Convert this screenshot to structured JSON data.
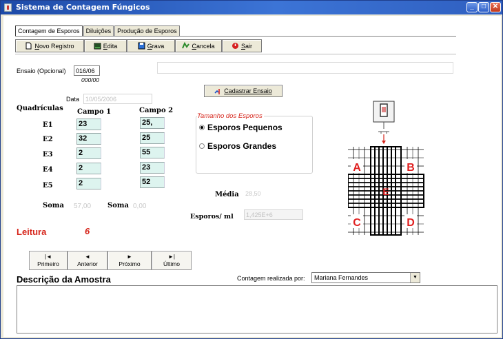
{
  "window": {
    "title": "Sistema de Contagem Fúngicos"
  },
  "tabs": [
    "Contagem de Esporos",
    "Diluições",
    "Produção de Esporos"
  ],
  "toolbar": {
    "novo": {
      "prefix": "",
      "key": "N",
      "rest": "ovo Registro"
    },
    "edita": {
      "key": "E",
      "rest": "dita"
    },
    "grava": {
      "key": "G",
      "rest": "rava"
    },
    "cancela": {
      "key": "C",
      "rest": "ancela"
    },
    "sair": {
      "key": "S",
      "rest": "air"
    }
  },
  "ensaio": {
    "label": "Ensaio (Opcional)",
    "value": "016/06",
    "hint": "000/00",
    "data_label": "Data",
    "data_value": "10/05/2006",
    "cadastrar": "Cadastrar Ensaio"
  },
  "grid": {
    "quadriculas_label": "Quadrículas",
    "campo1_label": "Campo 1",
    "campo2_label": "Campo 2",
    "rows": [
      {
        "label": "E1",
        "c1": "23",
        "c2": "25,"
      },
      {
        "label": "E2",
        "c1": "32",
        "c2": "25"
      },
      {
        "label": "E3",
        "c1": "2",
        "c2": "55"
      },
      {
        "label": "E4",
        "c1": "2",
        "c2": "23"
      },
      {
        "label": "E5",
        "c1": "2",
        "c2": "52"
      }
    ],
    "soma_label": "Soma",
    "soma1": "57,00",
    "soma2_label": "Soma",
    "soma2": "0,00"
  },
  "tamanho": {
    "title": "Tamanho dos Esporos",
    "options": [
      "Esporos Pequenos",
      "Esporos Grandes"
    ],
    "selected": 0
  },
  "media": {
    "label": "Média",
    "value": "28,50"
  },
  "esporos": {
    "label": "Esporos/ ml",
    "value": "1,425E+6"
  },
  "leitura": {
    "label": "Leitura",
    "value": "6"
  },
  "nav": [
    {
      "glyph": "|◄",
      "label": "Primeiro"
    },
    {
      "glyph": "◄",
      "label": "Anterior"
    },
    {
      "glyph": "►",
      "label": "Próximo"
    },
    {
      "glyph": "►|",
      "label": "Último"
    }
  ],
  "contagem": {
    "label": "Contagem realizada por:",
    "value": "Mariana Fernandes"
  },
  "descricao": {
    "title": "Descrição da Amostra"
  },
  "diagram": {
    "labels": [
      "A",
      "B",
      "E",
      "C",
      "D"
    ]
  },
  "colors": {
    "title_bar": "#2a5bc4",
    "accent_red": "#d6261c",
    "cell_bg": "#ddf4ef"
  }
}
